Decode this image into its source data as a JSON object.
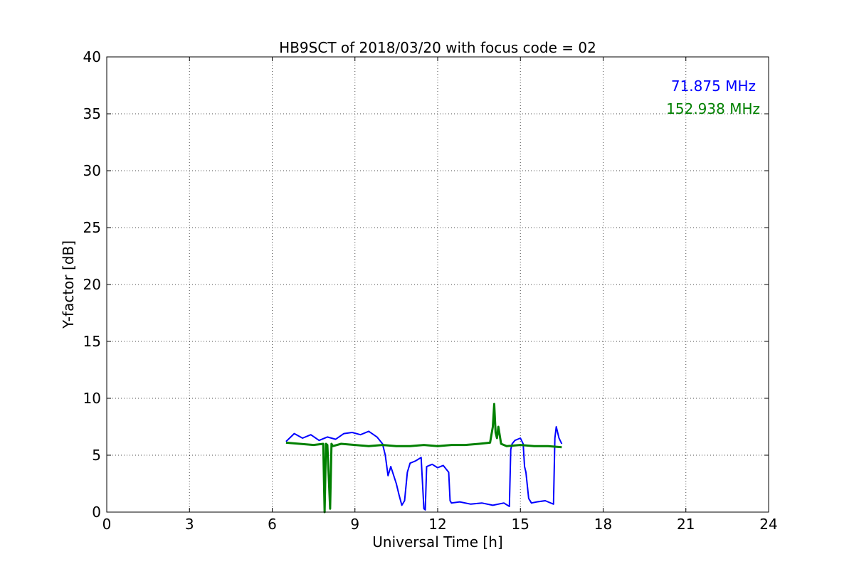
{
  "chart_data": {
    "type": "line",
    "title": "HB9SCT of 2018/03/20 with focus code = 02",
    "xlabel": "Universal Time [h]",
    "ylabel": "Y-factor [dB]",
    "xlim": [
      0,
      24
    ],
    "ylim": [
      0,
      40
    ],
    "xticks": [
      0,
      3,
      6,
      9,
      12,
      15,
      18,
      21,
      24
    ],
    "yticks": [
      0,
      5,
      10,
      15,
      20,
      25,
      30,
      35,
      40
    ],
    "grid": true,
    "legend_position": "top-right",
    "series": [
      {
        "name": "71.875 MHz",
        "color": "#0000ff",
        "x": [
          6.5,
          6.8,
          7.1,
          7.4,
          7.7,
          8.0,
          8.3,
          8.6,
          8.9,
          9.2,
          9.5,
          9.8,
          10.0,
          10.1,
          10.2,
          10.3,
          10.5,
          10.6,
          10.7,
          10.8,
          10.9,
          11.0,
          11.2,
          11.4,
          11.5,
          11.55,
          11.6,
          11.8,
          12.0,
          12.2,
          12.4,
          12.45,
          12.5,
          12.8,
          13.2,
          13.6,
          14.0,
          14.4,
          14.6,
          14.65,
          14.7,
          14.8,
          15.0,
          15.1,
          15.15,
          15.2,
          15.3,
          15.4,
          15.6,
          15.9,
          16.2,
          16.25,
          16.3,
          16.4,
          16.5
        ],
        "y": [
          6.2,
          6.9,
          6.5,
          6.8,
          6.3,
          6.6,
          6.4,
          6.9,
          7.0,
          6.8,
          7.1,
          6.6,
          6.0,
          5.0,
          3.2,
          4.0,
          2.5,
          1.5,
          0.6,
          1.0,
          3.5,
          4.3,
          4.5,
          4.8,
          0.3,
          0.2,
          4.0,
          4.2,
          3.9,
          4.1,
          3.5,
          1.0,
          0.8,
          0.9,
          0.7,
          0.8,
          0.6,
          0.8,
          0.5,
          5.5,
          6.0,
          6.3,
          6.5,
          6.0,
          4.0,
          3.5,
          1.2,
          0.8,
          0.9,
          1.0,
          0.7,
          6.5,
          7.5,
          6.5,
          6.0
        ]
      },
      {
        "name": "152.938 MHz",
        "color": "#008000",
        "x": [
          6.5,
          7.0,
          7.5,
          7.85,
          7.9,
          7.95,
          8.0,
          8.1,
          8.15,
          8.2,
          8.5,
          9.0,
          9.5,
          10.0,
          10.5,
          11.0,
          11.5,
          12.0,
          12.5,
          13.0,
          13.5,
          13.9,
          14.0,
          14.05,
          14.1,
          14.15,
          14.2,
          14.3,
          14.4,
          14.5,
          15.0,
          15.5,
          16.0,
          16.5
        ],
        "y": [
          6.1,
          6.0,
          5.9,
          6.0,
          0.0,
          6.0,
          5.9,
          0.3,
          6.0,
          5.8,
          6.0,
          5.9,
          5.8,
          5.9,
          5.8,
          5.8,
          5.9,
          5.8,
          5.9,
          5.9,
          6.0,
          6.1,
          7.5,
          9.5,
          7.0,
          6.5,
          7.5,
          6.0,
          5.9,
          5.8,
          5.9,
          5.8,
          5.8,
          5.7
        ]
      }
    ]
  }
}
